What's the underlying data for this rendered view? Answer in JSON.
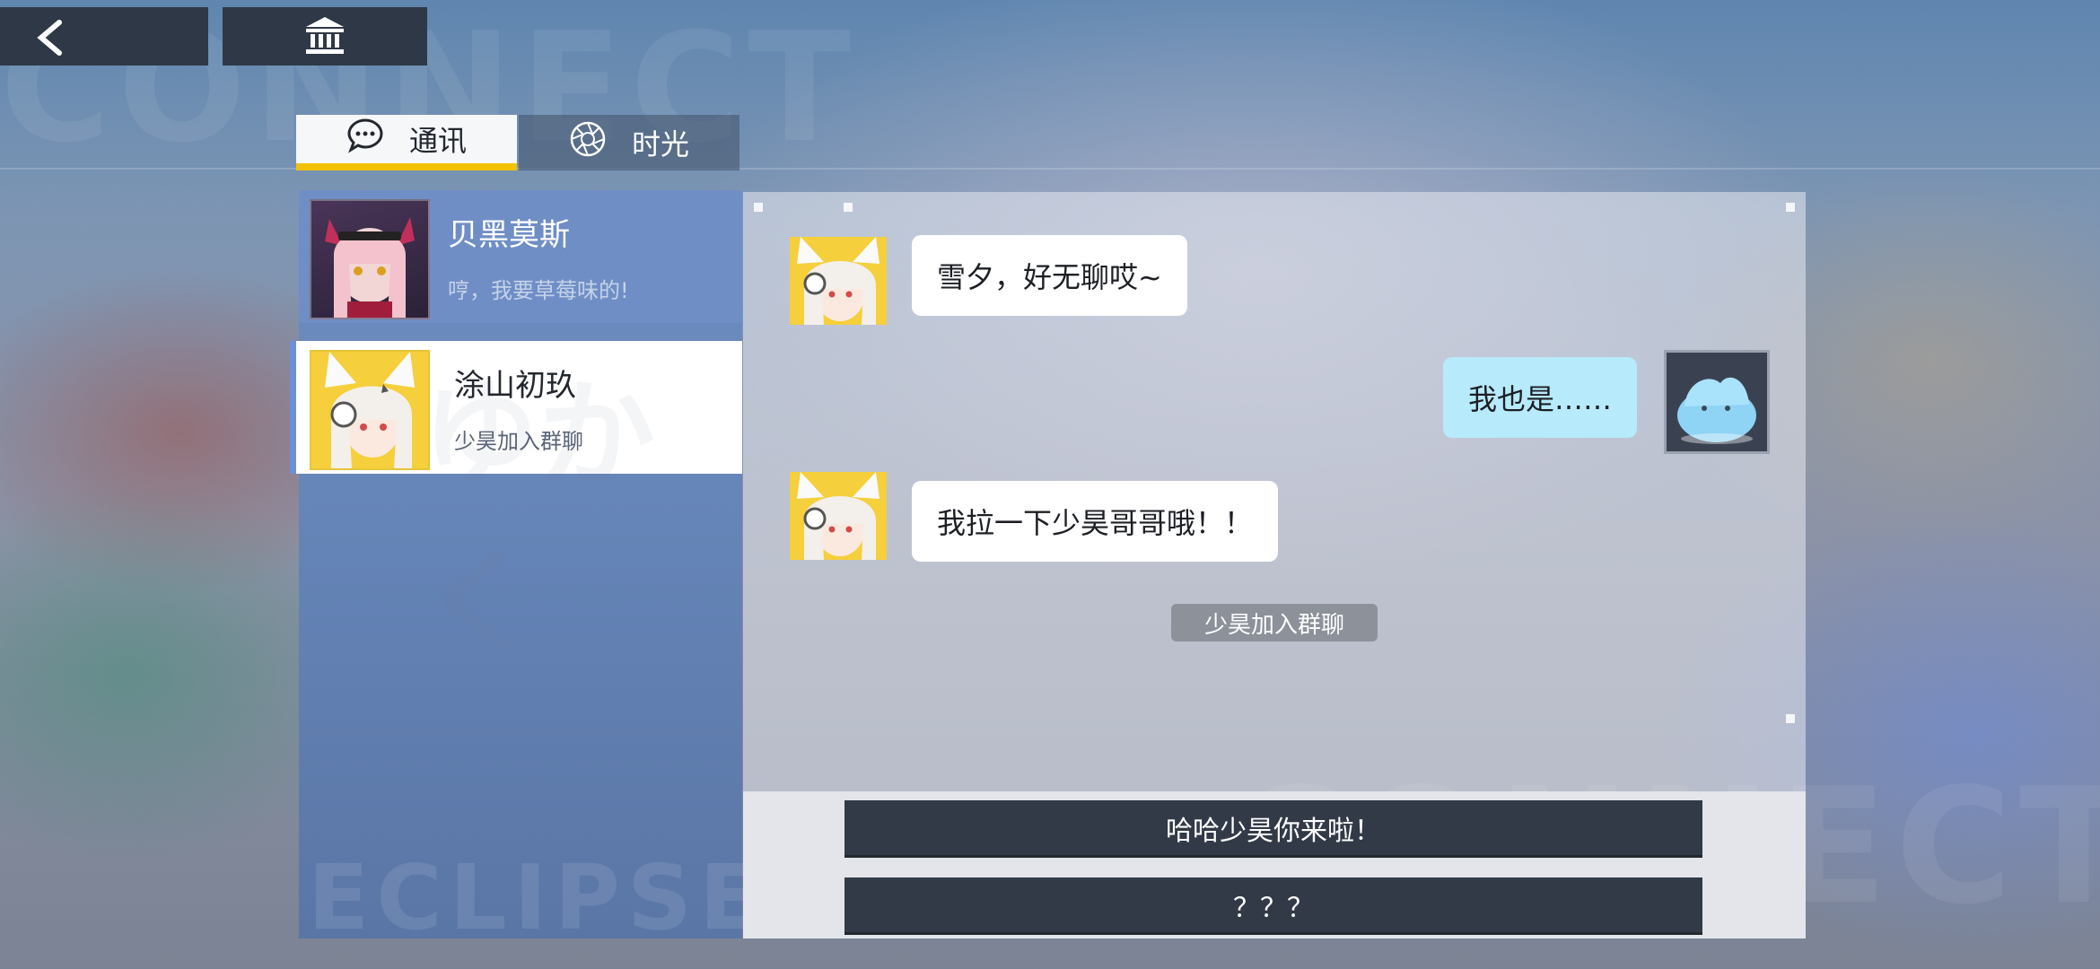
{
  "background": {
    "watermark_top": "CONNECT",
    "watermark_bottom_right": "CONNECT",
    "watermark_panel": "ECLIPSE",
    "watermark_contact": "ゆかく"
  },
  "toolbar": {
    "back_icon": "chevron-left-icon",
    "archive_icon": "bank-icon"
  },
  "tabs": [
    {
      "label": "通讯",
      "icon": "chat-bubble-icon",
      "active": true
    },
    {
      "label": "时光",
      "icon": "aperture-icon",
      "active": false
    }
  ],
  "contacts": [
    {
      "name": "贝黑莫斯",
      "preview": "哼，我要草莓味的!"
    },
    {
      "name": "涂山初玖",
      "preview": "少昊加入群聊"
    }
  ],
  "messages": [
    {
      "side": "left",
      "text": "雪夕，好无聊哎~"
    },
    {
      "side": "right",
      "text": "我也是……"
    },
    {
      "side": "left",
      "text": "我拉一下少昊哥哥哦！！"
    }
  ],
  "system_notice": "少昊加入群聊",
  "options": [
    "哈哈少昊你来啦！",
    "？？？"
  ],
  "colors": {
    "accent": "#f2c200",
    "contact_panel": "#6584b7",
    "player_bubble": "#b7eafb",
    "option_bg": "#323a47"
  }
}
